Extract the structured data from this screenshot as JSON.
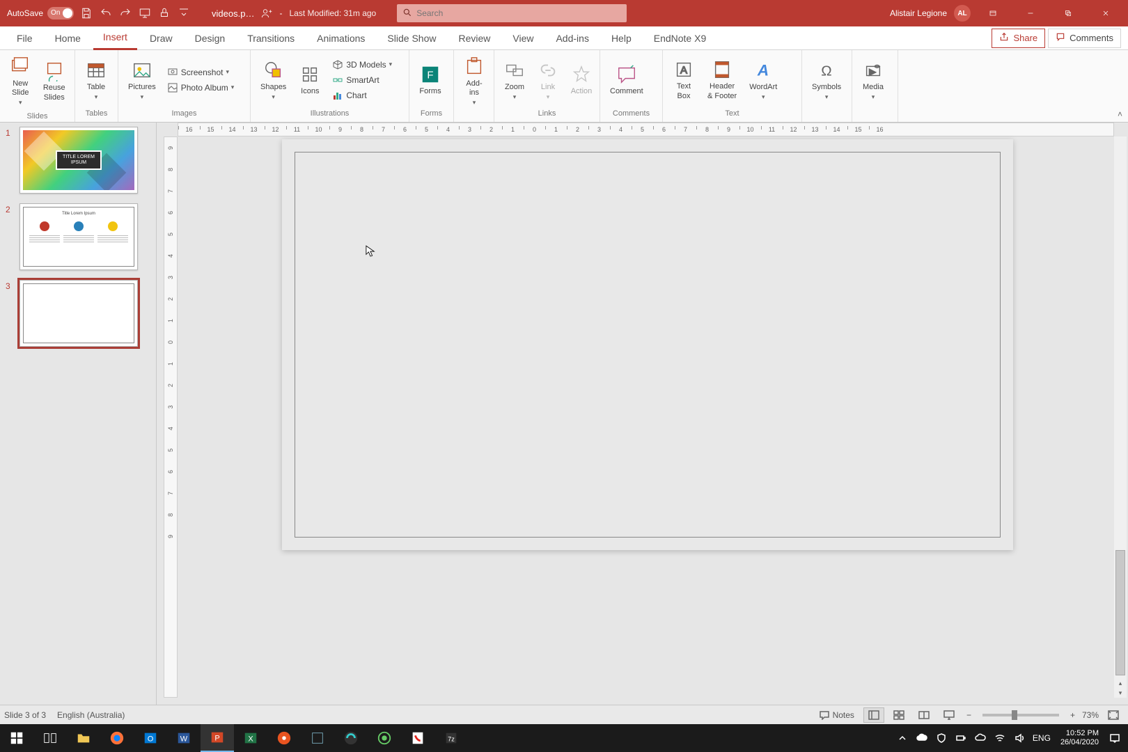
{
  "title_bar": {
    "autosave_label": "AutoSave",
    "autosave_state": "On",
    "file_name": "videos.p…",
    "last_modified": "Last Modified: 31m ago",
    "separator": " - ",
    "search_placeholder": "Search",
    "user_name": "Alistair Legione",
    "user_initials": "AL"
  },
  "ribbon_tabs": [
    "File",
    "Home",
    "Insert",
    "Draw",
    "Design",
    "Transitions",
    "Animations",
    "Slide Show",
    "Review",
    "View",
    "Add-ins",
    "Help",
    "EndNote X9"
  ],
  "active_tab": "Insert",
  "share_label": "Share",
  "comments_label": "Comments",
  "ribbon": {
    "slides": {
      "label": "Slides",
      "new_slide": "New\nSlide",
      "reuse_slides": "Reuse\nSlides"
    },
    "tables": {
      "label": "Tables",
      "table": "Table"
    },
    "images": {
      "label": "Images",
      "pictures": "Pictures",
      "screenshot": "Screenshot",
      "photo_album": "Photo Album"
    },
    "illustrations": {
      "label": "Illustrations",
      "shapes": "Shapes",
      "icons": "Icons",
      "models": "3D Models",
      "smartart": "SmartArt",
      "chart": "Chart"
    },
    "forms": {
      "label": "Forms",
      "forms": "Forms"
    },
    "addins": {
      "label": "",
      "addins": "Add-\nins"
    },
    "links": {
      "label": "Links",
      "zoom": "Zoom",
      "link": "Link",
      "action": "Action"
    },
    "comments": {
      "label": "Comments",
      "comment": "Comment"
    },
    "text": {
      "label": "Text",
      "text_box": "Text\nBox",
      "header_footer": "Header\n& Footer",
      "wordart": "WordArt"
    },
    "symbols": {
      "label": "",
      "symbols": "Symbols"
    },
    "media": {
      "label": "",
      "media": "Media"
    }
  },
  "slides_panel": {
    "thumbs": [
      {
        "number": "1",
        "title": "TITLE LOREM\nIPSUM"
      },
      {
        "number": "2",
        "title": "Title Lorem Ipsum"
      },
      {
        "number": "3",
        "title": ""
      }
    ],
    "selected_index": 2
  },
  "ruler_h": [
    "16",
    "15",
    "14",
    "13",
    "12",
    "11",
    "10",
    "9",
    "8",
    "7",
    "6",
    "5",
    "4",
    "3",
    "2",
    "1",
    "0",
    "1",
    "2",
    "3",
    "4",
    "5",
    "6",
    "7",
    "8",
    "9",
    "10",
    "11",
    "12",
    "13",
    "14",
    "15",
    "16"
  ],
  "ruler_v": [
    "9",
    "8",
    "7",
    "6",
    "5",
    "4",
    "3",
    "2",
    "1",
    "0",
    "1",
    "2",
    "3",
    "4",
    "5",
    "6",
    "7",
    "8",
    "9"
  ],
  "status": {
    "slide_status": "Slide 3 of 3",
    "language": "English (Australia)",
    "notes_label": "Notes",
    "zoom": "73%"
  },
  "taskbar": {
    "lang": "ENG",
    "time": "10:52 PM",
    "date": "26/04/2020"
  }
}
